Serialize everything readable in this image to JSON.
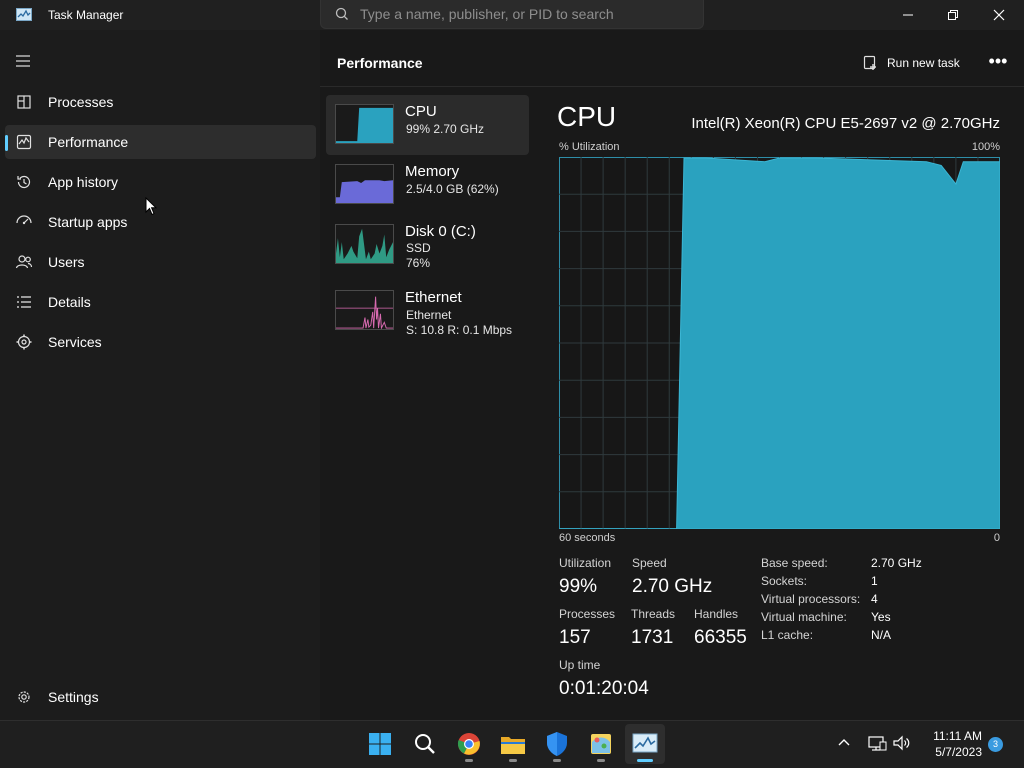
{
  "window": {
    "title": "Task Manager"
  },
  "search": {
    "placeholder": "Type a name, publisher, or PID to search"
  },
  "nav": {
    "items": [
      {
        "label": "Processes",
        "icon": "processes-icon"
      },
      {
        "label": "Performance",
        "icon": "performance-icon",
        "active": true
      },
      {
        "label": "App history",
        "icon": "history-icon"
      },
      {
        "label": "Startup apps",
        "icon": "startup-icon"
      },
      {
        "label": "Users",
        "icon": "users-icon"
      },
      {
        "label": "Details",
        "icon": "details-icon"
      },
      {
        "label": "Services",
        "icon": "services-icon"
      }
    ],
    "settings_label": "Settings"
  },
  "header": {
    "title": "Performance",
    "run_task_label": "Run new task",
    "more_label": "•••"
  },
  "resources": [
    {
      "name": "CPU",
      "line1": "99%  2.70 GHz",
      "line2": "",
      "active": true
    },
    {
      "name": "Memory",
      "line1": "2.5/4.0 GB (62%)",
      "line2": ""
    },
    {
      "name": "Disk 0 (C:)",
      "line1": "SSD",
      "line2": "76%"
    },
    {
      "name": "Ethernet",
      "line1": "Ethernet",
      "line2": "S: 10.8  R: 0.1 Mbps"
    }
  ],
  "cpu": {
    "title": "CPU",
    "model": "Intel(R) Xeon(R) CPU E5-2697 v2 @ 2.70GHz",
    "graph_label": "% Utilization",
    "graph_max": "100%",
    "graph_time": "60 seconds",
    "graph_zero": "0",
    "stats": {
      "utilization_label": "Utilization",
      "utilization": "99%",
      "speed_label": "Speed",
      "speed": "2.70 GHz",
      "processes_label": "Processes",
      "processes": "157",
      "threads_label": "Threads",
      "threads": "1731",
      "handles_label": "Handles",
      "handles": "66355",
      "uptime_label": "Up time",
      "uptime": "0:01:20:04"
    },
    "specs": [
      {
        "label": "Base speed:",
        "value": "2.70 GHz"
      },
      {
        "label": "Sockets:",
        "value": "1"
      },
      {
        "label": "Virtual processors:",
        "value": "4"
      },
      {
        "label": "Virtual machine:",
        "value": "Yes"
      },
      {
        "label": "L1 cache:",
        "value": "N/A"
      }
    ]
  },
  "chart_data": {
    "type": "area",
    "x": [
      60,
      44,
      43,
      40,
      32,
      30,
      25,
      10,
      8,
      6,
      5,
      3,
      0
    ],
    "values": [
      0,
      0,
      100,
      100,
      99,
      100,
      100,
      99,
      98,
      93,
      99,
      99,
      99
    ],
    "ylim": [
      0,
      100
    ],
    "xlim": [
      60,
      0
    ],
    "color": "#2aa2bf"
  },
  "taskbar": {
    "apps": [
      "windows-start-icon",
      "search-icon",
      "chrome-icon",
      "file-explorer-icon",
      "defender-icon",
      "paint-icon",
      "task-manager-icon"
    ],
    "time": "11:11 AM",
    "date": "5/7/2023",
    "notifications": "3"
  },
  "colors": {
    "accent": "#60cdff",
    "cpu": "#2aa2bf",
    "memory": "#6a6ad8",
    "disk": "#3fa893",
    "ethernet": "#d86ab0"
  }
}
